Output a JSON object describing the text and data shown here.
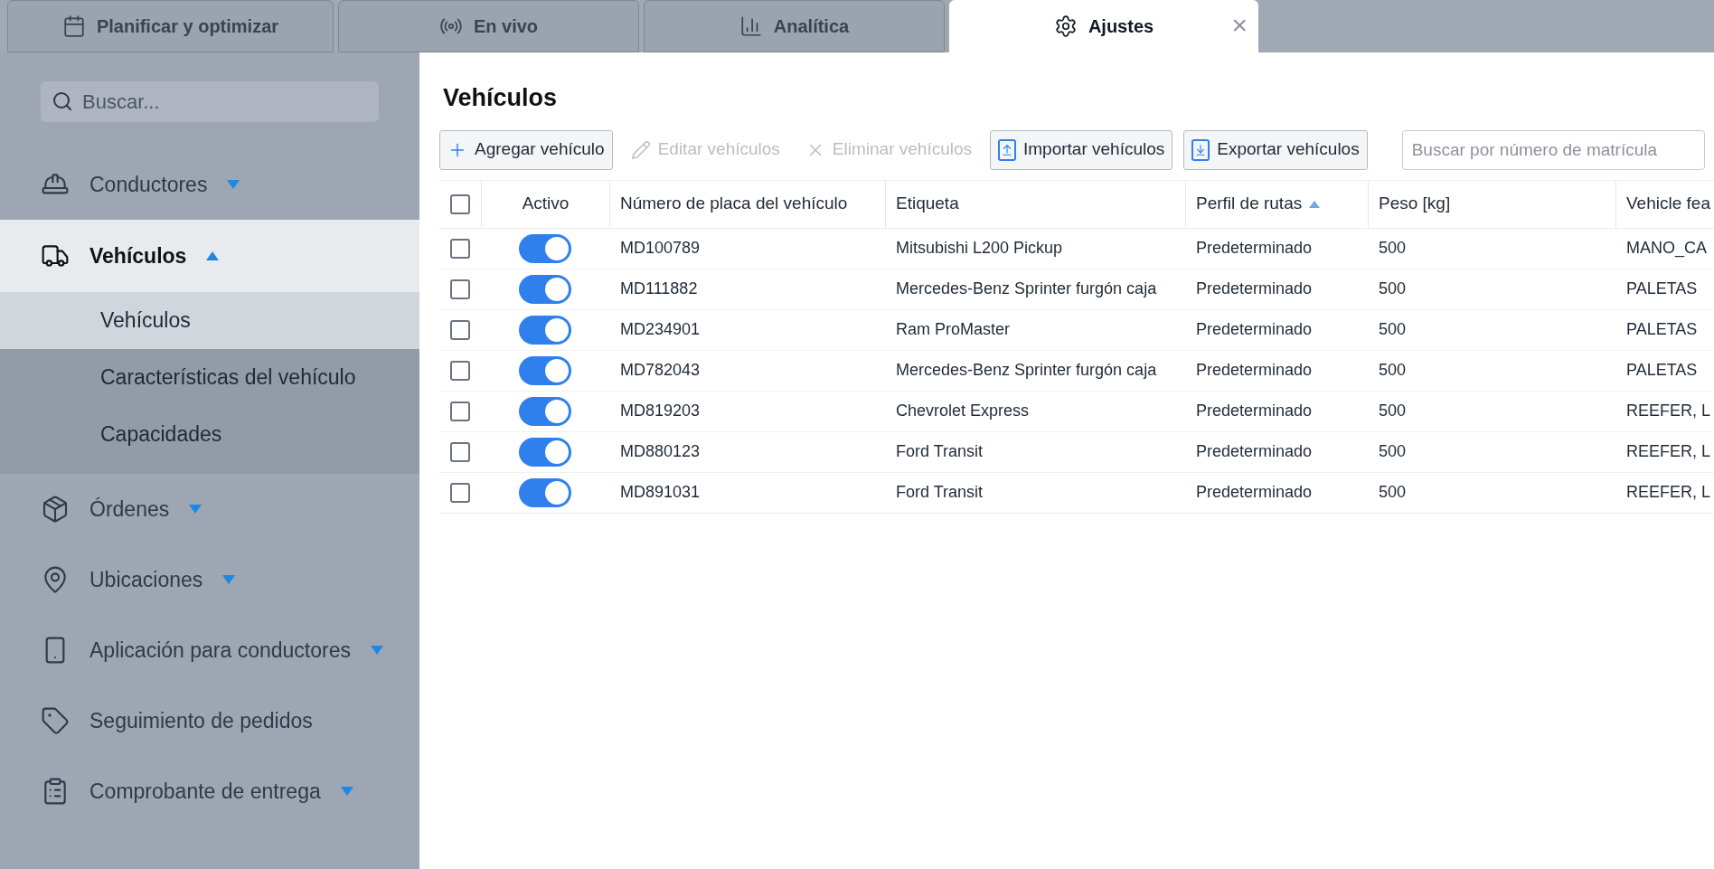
{
  "tabs": [
    {
      "label": "Planificar y optimizar",
      "selected": false
    },
    {
      "label": "En vivo",
      "selected": false
    },
    {
      "label": "Analítica",
      "selected": false
    },
    {
      "label": "Ajustes",
      "selected": true,
      "close_symbol": "×"
    }
  ],
  "sidebar": {
    "search": {
      "placeholder": "Buscar..."
    },
    "items": [
      {
        "label": "Conductores",
        "expanded": false,
        "selected": false
      },
      {
        "label": "Vehículos",
        "expanded": true,
        "selected": true,
        "children": [
          {
            "label": "Vehículos",
            "selected": true
          },
          {
            "label": "Características del vehículo",
            "selected": false
          },
          {
            "label": "Capacidades",
            "selected": false
          }
        ]
      },
      {
        "label": "Órdenes",
        "expanded": false,
        "selected": false
      },
      {
        "label": "Ubicaciones",
        "expanded": false,
        "selected": false
      },
      {
        "label": "Aplicación para conductores",
        "expanded": false,
        "selected": false
      },
      {
        "label": "Seguimiento de pedidos",
        "selected": false
      },
      {
        "label": "Comprobante de entrega",
        "expanded": false,
        "selected": false
      }
    ]
  },
  "page": {
    "title": "Vehículos",
    "toolbar": [
      {
        "label": "Agregar vehículo",
        "disabled": false
      },
      {
        "label": "Editar vehículos",
        "disabled": true
      },
      {
        "label": "Eliminar vehículos",
        "disabled": true
      },
      {
        "label": "Importar vehículos",
        "disabled": false
      },
      {
        "label": "Exportar vehículos",
        "disabled": false
      }
    ],
    "search": {
      "placeholder": "Buscar por número de matrícula"
    },
    "table": {
      "all_checked": false,
      "columns": [
        {
          "label": "Activo",
          "sorted": false
        },
        {
          "label": "Número de placa del vehículo",
          "sorted": false
        },
        {
          "label": "Etiqueta",
          "sorted": false
        },
        {
          "label": "Perfil de rutas",
          "sorted": true
        },
        {
          "label": "Peso [kg]",
          "sorted": false
        },
        {
          "label": "Vehicle fea",
          "sorted": false
        }
      ],
      "rows": [
        {
          "checked": false,
          "active": true,
          "plate": "MD100789",
          "label": "Mitsubishi L200 Pickup",
          "profile": "Predeterminado",
          "weight": "500",
          "features": "MANO_CA"
        },
        {
          "checked": false,
          "active": true,
          "plate": "MD111882",
          "label": "Mercedes-Benz Sprinter furgón caja",
          "profile": "Predeterminado",
          "weight": "500",
          "features": "PALETAS"
        },
        {
          "checked": false,
          "active": true,
          "plate": "MD234901",
          "label": "Ram ProMaster",
          "profile": "Predeterminado",
          "weight": "500",
          "features": "PALETAS"
        },
        {
          "checked": false,
          "active": true,
          "plate": "MD782043",
          "label": "Mercedes-Benz Sprinter furgón caja",
          "profile": "Predeterminado",
          "weight": "500",
          "features": "PALETAS"
        },
        {
          "checked": false,
          "active": true,
          "plate": "MD819203",
          "label": "Chevrolet Express",
          "profile": "Predeterminado",
          "weight": "500",
          "features": "REEFER, L"
        },
        {
          "checked": false,
          "active": true,
          "plate": "MD880123",
          "label": "Ford Transit",
          "profile": "Predeterminado",
          "weight": "500",
          "features": "REEFER, L"
        },
        {
          "checked": false,
          "active": true,
          "plate": "MD891031",
          "label": "Ford Transit",
          "profile": "Predeterminado",
          "weight": "500",
          "features": "REEFER, L"
        }
      ]
    }
  }
}
